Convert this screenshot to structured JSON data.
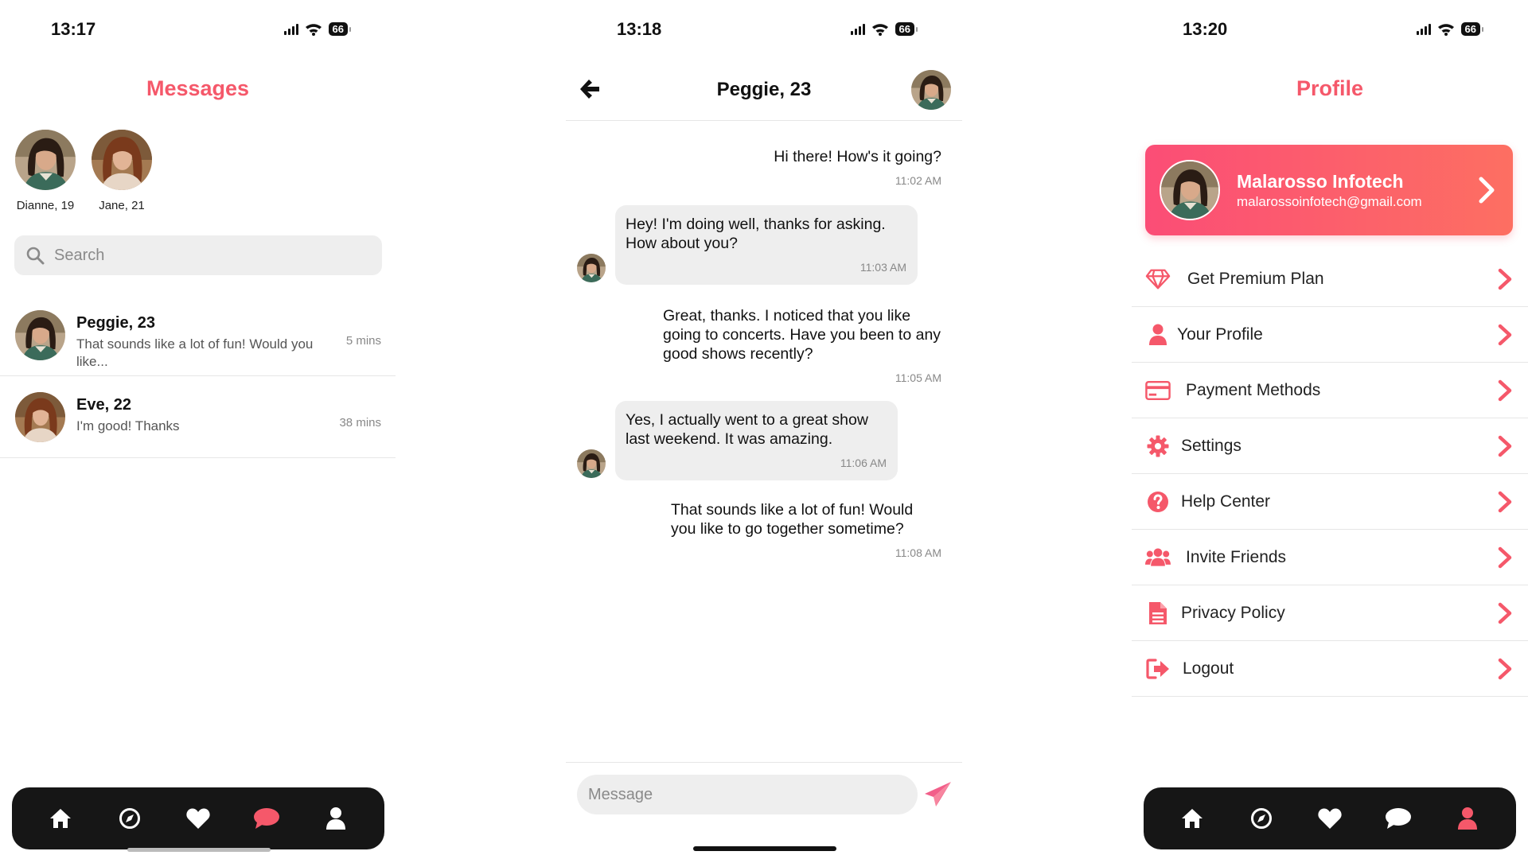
{
  "accent_color": "#f5586a",
  "screen_messages": {
    "status": {
      "time": "13:17",
      "battery": "66"
    },
    "title": "Messages",
    "stories": [
      {
        "name": "Dianne, 19",
        "avatar": "woman-dark-hair"
      },
      {
        "name": "Jane, 21",
        "avatar": "woman-auburn-hair"
      }
    ],
    "search": {
      "placeholder": "Search"
    },
    "conversations": [
      {
        "name": "Peggie, 23",
        "message": "That sounds like a lot of fun! Would you like...",
        "time": "5 mins"
      },
      {
        "name": "Eve, 22",
        "message": "I'm good! Thanks",
        "time": "38 mins"
      }
    ],
    "tabbar": {
      "active": "chat",
      "tabs": [
        "home-icon",
        "compass-icon",
        "heart-icon",
        "chat-icon",
        "user-icon"
      ]
    }
  },
  "screen_chat": {
    "status": {
      "time": "13:18",
      "battery": "66"
    },
    "title": "Peggie, 23",
    "messages": [
      {
        "from": "me",
        "text": "Hi there! How's it going?",
        "time": "11:02 AM"
      },
      {
        "from": "them",
        "text": "Hey! I'm doing well, thanks for asking. How about you?",
        "time": "11:03 AM"
      },
      {
        "from": "me",
        "text": "Great, thanks. I noticed that you like going to concerts. Have you been to any good shows recently?",
        "time": "11:05 AM"
      },
      {
        "from": "them",
        "text": "Yes, I actually went to a great show last weekend. It was amazing.",
        "time": "11:06 AM"
      },
      {
        "from": "me",
        "text": "That sounds like a lot of fun! Would you like to go together sometime?",
        "time": "11:08 AM"
      }
    ],
    "composer": {
      "placeholder": "Message"
    }
  },
  "screen_profile": {
    "status": {
      "time": "13:20",
      "battery": "66"
    },
    "title": "Profile",
    "user": {
      "name": "Malarosso Infotech",
      "email": "malarossoinfotech@gmail.com"
    },
    "menu": [
      {
        "label": "Get Premium Plan",
        "icon": "diamond-icon"
      },
      {
        "label": "Your Profile",
        "icon": "user-icon"
      },
      {
        "label": "Payment Methods",
        "icon": "credit-card-icon"
      },
      {
        "label": "Settings",
        "icon": "gear-icon"
      },
      {
        "label": "Help Center",
        "icon": "question-circle-icon"
      },
      {
        "label": "Invite Friends",
        "icon": "users-icon"
      },
      {
        "label": "Privacy Policy",
        "icon": "document-icon"
      },
      {
        "label": "Logout",
        "icon": "logout-icon"
      }
    ],
    "tabbar": {
      "active": "user"
    }
  }
}
